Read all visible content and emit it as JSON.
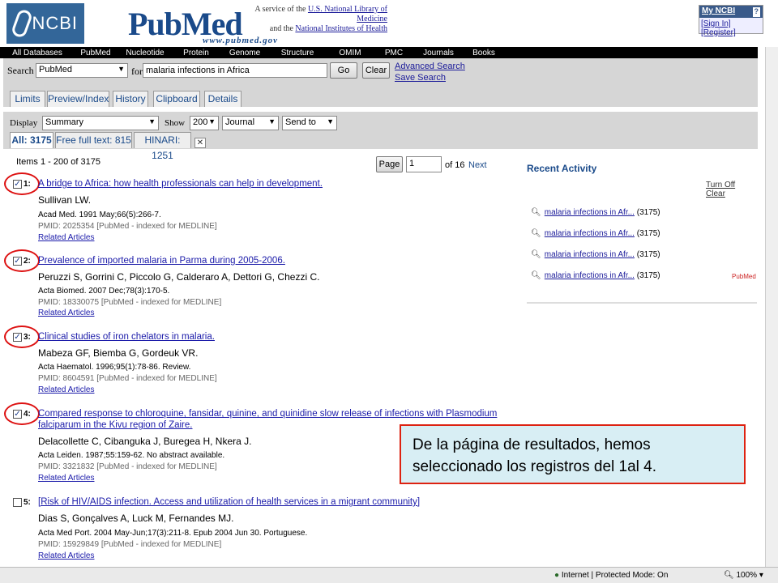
{
  "header": {
    "ncbi_label": "NCBI",
    "pubmed_logo": "PubMed",
    "pubmed_url": "www.pubmed.gov",
    "service_line1": "A service of the",
    "service_link1": "U.S. National Library of Medicine",
    "service_line2": "and the",
    "service_link2": "National Institutes of Health",
    "myncbi_title": "My NCBI",
    "myncbi_help": "?",
    "signin": "[Sign In]",
    "register": "[Register]"
  },
  "nav": [
    "All Databases",
    "PubMed",
    "Nucleotide",
    "Protein",
    "Genome",
    "Structure",
    "OMIM",
    "PMC",
    "Journals",
    "Books"
  ],
  "search": {
    "label": "Search",
    "database": "PubMed",
    "for_label": "for",
    "query": "malaria infections in Africa",
    "go": "Go",
    "clear": "Clear",
    "advanced": "Advanced Search",
    "save": "Save Search"
  },
  "tabs": [
    "Limits",
    "Preview/Index",
    "History",
    "Clipboard",
    "Details"
  ],
  "display": {
    "label": "Display",
    "format": "Summary",
    "show_label": "Show",
    "count": "200",
    "sort": "Journal",
    "send": "Send to"
  },
  "subtabs": {
    "all": "All: 3175",
    "free": "Free full text: 815",
    "hinari": "HINARI: 1251"
  },
  "paging": {
    "items": "Items 1 - 200 of 3175",
    "page_btn": "Page",
    "page_value": "1",
    "of": "of 16",
    "next": "Next"
  },
  "results": [
    {
      "num": "1:",
      "checked": true,
      "title": "A bridge to Africa: how health professionals can help in development.",
      "authors": "Sullivan LW.",
      "source": "Acad Med. 1991 May;66(5):266-7.",
      "pmid": "PMID: 2025354 [PubMed - indexed for MEDLINE]",
      "related": "Related Articles"
    },
    {
      "num": "2:",
      "checked": true,
      "title": "Prevalence of imported malaria in Parma during 2005-2006.",
      "authors": "Peruzzi S, Gorrini C, Piccolo G, Calderaro A, Dettori G, Chezzi C.",
      "source": "Acta Biomed. 2007 Dec;78(3):170-5.",
      "pmid": "PMID: 18330075 [PubMed - indexed for MEDLINE]",
      "related": "Related Articles"
    },
    {
      "num": "3:",
      "checked": true,
      "title": "Clinical studies of iron chelators in malaria.",
      "authors": "Mabeza GF, Biemba G, Gordeuk VR.",
      "source": "Acta Haematol. 1996;95(1):78-86. Review.",
      "pmid": "PMID: 8604591 [PubMed - indexed for MEDLINE]",
      "related": "Related Articles"
    },
    {
      "num": "4:",
      "checked": true,
      "title": "Compared response to chloroquine, fansidar, quinine, and quinidine slow release of infections with Plasmodium",
      "title2": "falciparum in the Kivu region of Zaire.",
      "authors": "Delacollette C, Cibanguka J, Buregea H, Nkera J.",
      "source": "Acta Leiden. 1987;55:159-62. No abstract available.",
      "pmid": "PMID: 3321832 [PubMed - indexed for MEDLINE]",
      "related": "Related Articles"
    },
    {
      "num": "5:",
      "checked": false,
      "title": "[Risk of HIV/AIDS infection. Access and utilization of health services in a migrant community]",
      "authors": "Dias S, Gonçalves A, Luck M, Fernandes MJ.",
      "source": "Acta Med Port. 2004 May-Jun;17(3):211-8. Epub 2004 Jun 30. Portuguese.",
      "pmid": "PMID: 15929849 [PubMed - indexed for MEDLINE]",
      "related": "Related Articles"
    }
  ],
  "recent": {
    "title": "Recent Activity",
    "turn_off": "Turn Off",
    "clear": "Clear",
    "items": [
      {
        "text": "malaria infections in Afr...",
        "count": "(3175)"
      },
      {
        "text": "malaria infections in Afr...",
        "count": "(3175)"
      },
      {
        "text": "malaria infections in Afr...",
        "count": "(3175)"
      },
      {
        "text": "malaria infections in Afr...",
        "count": "(3175)"
      }
    ],
    "tag": "PubMed"
  },
  "callout": {
    "line1": "De la página de resultados, hemos",
    "line2": "seleccionado los registros del 1al 4."
  },
  "status": {
    "internet": "Internet | Protected Mode: On",
    "zoom": "100%"
  },
  "colors": {
    "ncbi_blue": "#336699",
    "highlight_red": "#dd1111",
    "callout_bg": "#d8eef4"
  }
}
